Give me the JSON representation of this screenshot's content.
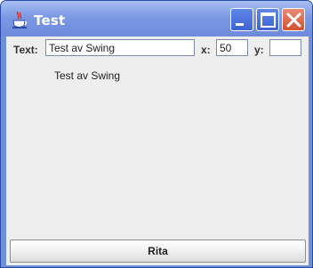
{
  "window": {
    "title": "Test",
    "icon": "java-cup-icon",
    "controls": [
      "minimize-icon",
      "maximize-icon",
      "close-icon"
    ]
  },
  "form": {
    "text_label": "Text:",
    "text_value": "Test av Swing",
    "x_label": "x:",
    "x_value": "50",
    "y_label": "y:",
    "y_value": ""
  },
  "canvas": {
    "drawn_text": "Test av Swing"
  },
  "actions": {
    "draw_button": "Rita"
  },
  "colors": {
    "title_bar": "#7b98e3",
    "close_button": "#d2502f",
    "panel_background": "#eeeeee"
  }
}
